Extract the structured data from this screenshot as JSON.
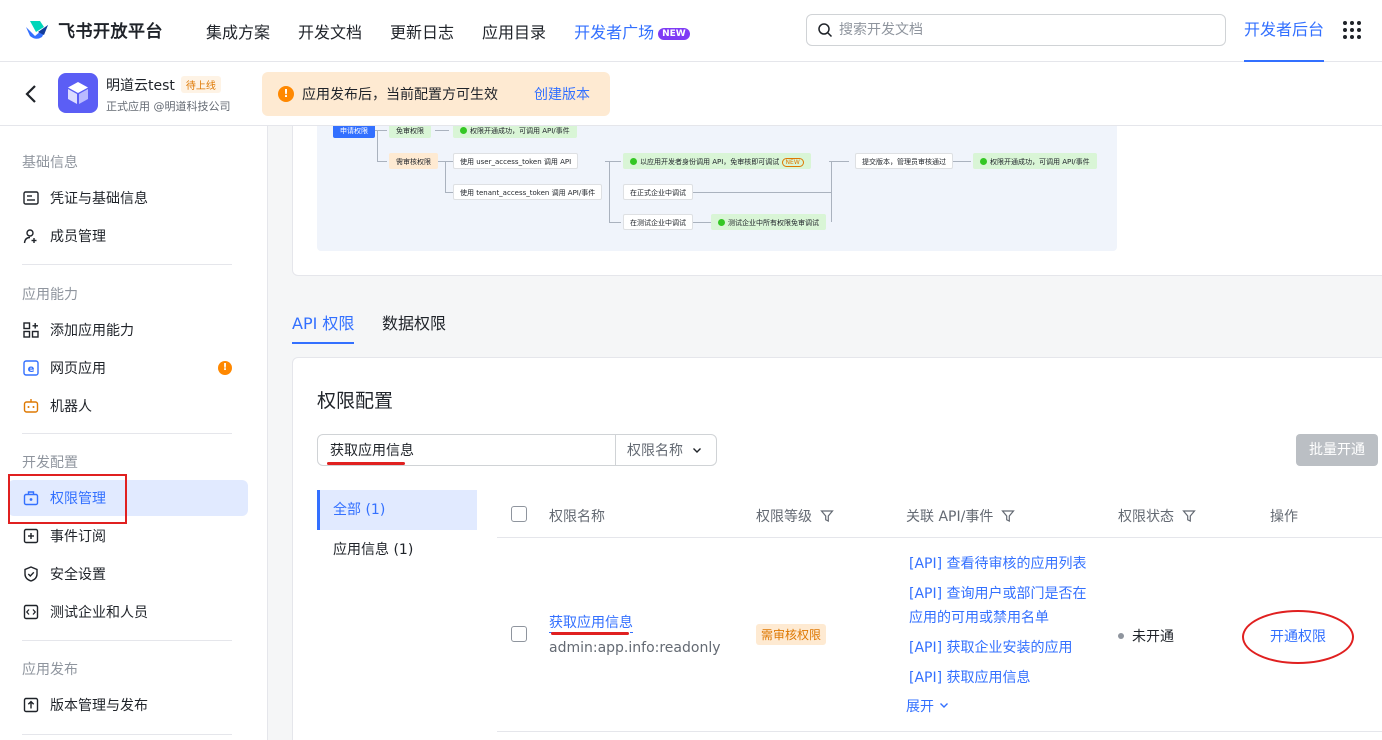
{
  "colors": {
    "accent": "#3370ff",
    "warning": "#ff8800",
    "annotation": "#e02020"
  },
  "header": {
    "brand": "飞书开放平台",
    "nav": [
      "集成方案",
      "开发文档",
      "更新日志",
      "应用目录"
    ],
    "nav_active": "开发者广场",
    "new_badge": "NEW",
    "search_placeholder": "搜索开发文档",
    "console": "开发者后台"
  },
  "app": {
    "name": "明道云test",
    "tag": "待上线",
    "subtitle": "正式应用 @明道科技公司",
    "notice": "应用发布后，当前配置方可生效",
    "notice_link": "创建版本"
  },
  "sidebar": {
    "sections": [
      "基础信息",
      "应用能力",
      "开发配置",
      "应用发布"
    ],
    "items": [
      "凭证与基础信息",
      "成员管理",
      "添加应用能力",
      "网页应用",
      "机器人",
      "权限管理",
      "事件订阅",
      "安全设置",
      "测试企业和人员",
      "版本管理与发布"
    ],
    "warn_mark": "!"
  },
  "flow": {
    "apply": "申请权限",
    "no_review": "免审权限",
    "success1": "权限开通成功，可调用 API/事件",
    "need_review": "需审核权限",
    "user_token": "使用 user_access_token 调用 API",
    "dev_identity": "以应用开发者身份调用 API，免审核即可调试",
    "new": "NEW",
    "submit": "提交版本，管理员审核通过",
    "success2": "权限开通成功，可调用 API/事件",
    "tenant_token": "使用 tenant_access_token 调用 API/事件",
    "prod_debug": "在正式企业中调试",
    "test_debug": "在测试企业中调试",
    "test_free": "测试企业中所有权限免审调试"
  },
  "tabs": [
    "API 权限",
    "数据权限"
  ],
  "perm": {
    "title": "权限配置",
    "filter_value": "获取应用信息",
    "filter_select": "权限名称",
    "bulk": "批量开通",
    "categories": [
      "全部 (1)",
      "应用信息 (1)"
    ],
    "columns": [
      "权限名称",
      "权限等级",
      "关联 API/事件",
      "权限状态",
      "操作"
    ],
    "rows": [
      {
        "name": "获取应用信息",
        "code": "admin:app.info:readonly",
        "level": "需审核权限",
        "apis": [
          "[API] 查看待审核的应用列表",
          "[API] 查询用户或部门是否在应用的可用或禁用名单",
          "[API] 获取企业安装的应用",
          "[API] 获取应用信息"
        ],
        "expand": "展开",
        "status": "未开通",
        "action": "开通权限"
      }
    ]
  }
}
